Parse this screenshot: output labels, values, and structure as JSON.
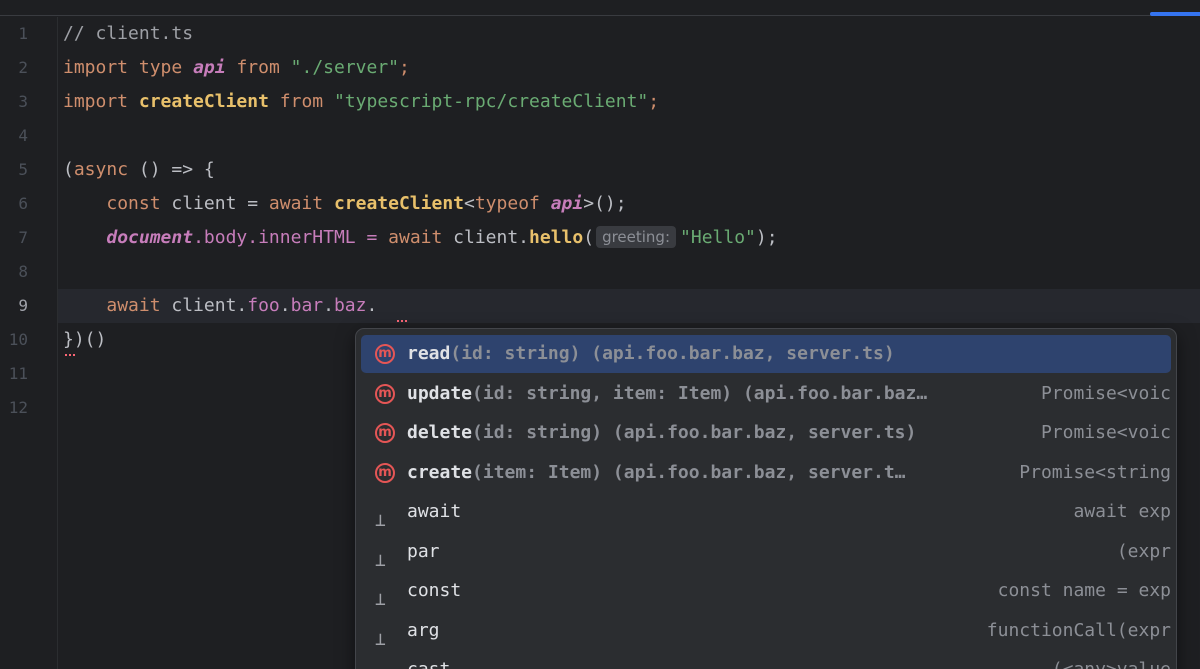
{
  "editor": {
    "file_comment": "// client.ts",
    "current_line": "9",
    "line_numbers": [
      "1",
      "2",
      "3",
      "4",
      "5",
      "6",
      "7",
      "8",
      "9",
      "10",
      "11",
      "12"
    ],
    "lines": {
      "l2": {
        "import": "import",
        "type": "type",
        "api": "api",
        "from": "from",
        "path": "\"./server\"",
        "semi": ";"
      },
      "l3": {
        "import": "import",
        "name": "createClient",
        "from": "from",
        "path": "\"typescript-rpc/createClient\"",
        "semi": ";"
      },
      "l5": {
        "open": "(",
        "async": "async",
        "rest": " () => {"
      },
      "l6": {
        "const": "const",
        "var": " client = ",
        "await": "await",
        "fn": "createClient",
        "lt": "<",
        "typeof": "typeof",
        "api": "api",
        "tail": ">();"
      },
      "l7": {
        "document": "document",
        "mid": ".body.innerHTML = ",
        "await": "await",
        "client": " client.",
        "hello": "hello",
        "open": "(",
        "hint": "greeting:",
        "arg": "\"Hello\"",
        "close": ");"
      },
      "l9": {
        "await": "await",
        "client": " client.",
        "foo": "foo",
        "d1": ".",
        "bar": "bar",
        "d2": ".",
        "baz": "baz",
        "d3": "."
      },
      "l10": {
        "text": "})()"
      }
    }
  },
  "completion": {
    "items": [
      {
        "icon": "method-icon",
        "name": "read",
        "sig": "(id: string) (api.foo.bar.baz, server.ts)",
        "ret": ""
      },
      {
        "icon": "method-icon",
        "name": "update",
        "sig": "(id: string, item: Item) (api.foo.bar.baz…",
        "ret": "Promise<voic"
      },
      {
        "icon": "method-icon",
        "name": "delete",
        "sig": "(id: string) (api.foo.bar.baz, server.ts)",
        "ret": "Promise<voic"
      },
      {
        "icon": "method-icon",
        "name": "create",
        "sig": "(item: Item) (api.foo.bar.baz, server.t…",
        "ret": "Promise<string"
      },
      {
        "icon": "template-icon",
        "name": "await",
        "sig": "",
        "ret": "await exp"
      },
      {
        "icon": "template-icon",
        "name": "par",
        "sig": "",
        "ret": "(expr"
      },
      {
        "icon": "template-icon",
        "name": "const",
        "sig": "",
        "ret": "const name = exp"
      },
      {
        "icon": "template-icon",
        "name": "arg",
        "sig": "",
        "ret": "functionCall(expr"
      },
      {
        "icon": "template-icon",
        "name": "cast",
        "sig": "",
        "ret": "(<any>value"
      }
    ],
    "method_glyph": "m",
    "template_glyph": "⊥"
  }
}
